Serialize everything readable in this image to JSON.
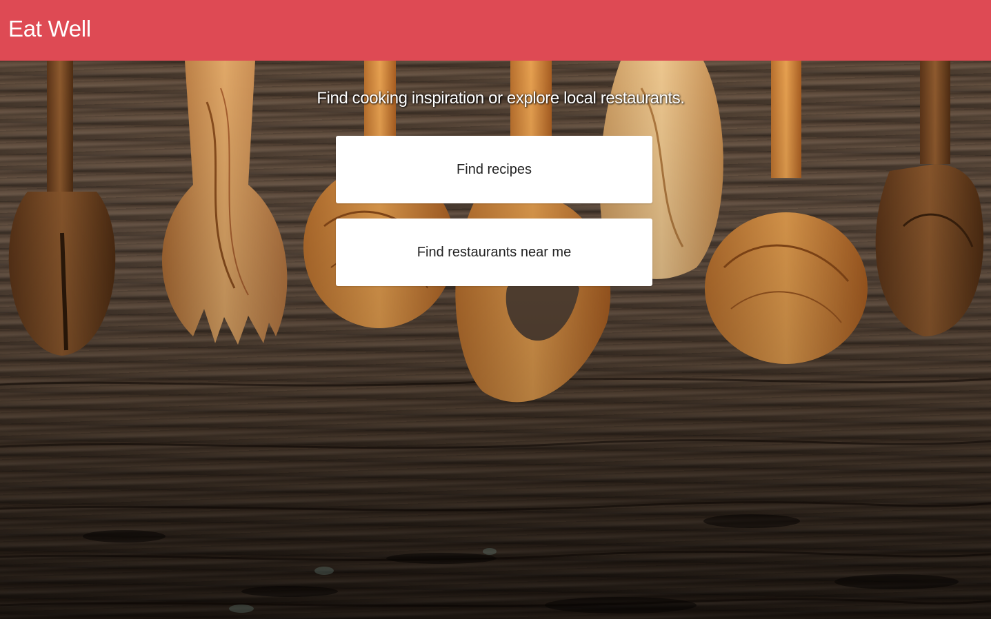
{
  "header": {
    "title": "Eat Well"
  },
  "hero": {
    "tagline": "Find cooking inspiration or explore local restaurants.",
    "background_image": "wooden-spoons-on-rustic-wood"
  },
  "actions": {
    "find_recipes_label": "Find recipes",
    "find_restaurants_label": "Find restaurants near me"
  },
  "colors": {
    "header_background": "#de4a54",
    "header_text": "#ffffff",
    "button_background": "#ffffff",
    "button_text": "#222222"
  }
}
